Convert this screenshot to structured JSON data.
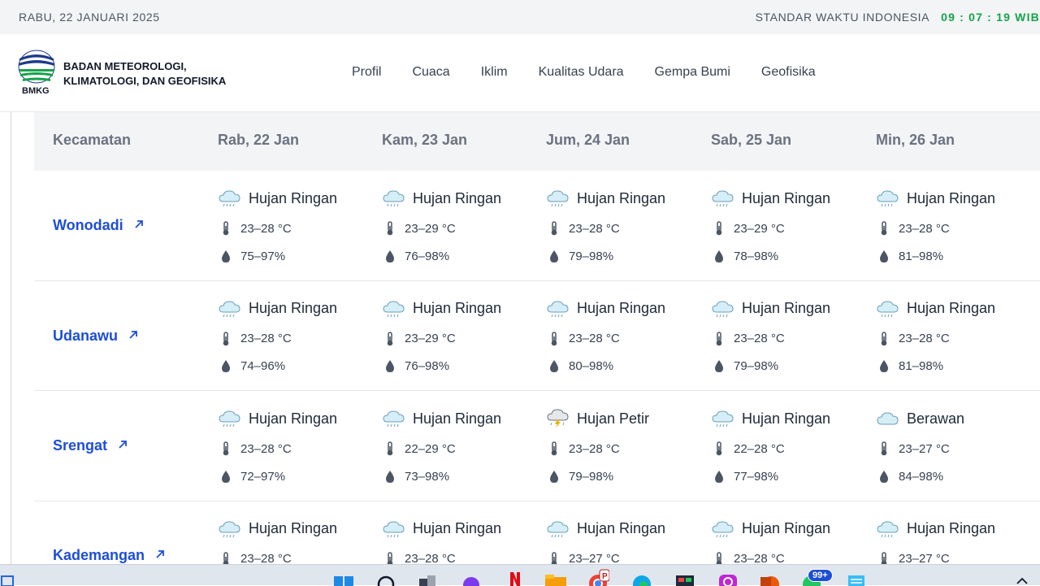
{
  "topbar": {
    "date": "RABU, 22 JANUARI 2025",
    "tz_label": "STANDAR WAKTU INDONESIA",
    "clock": "09 : 07 : 19 WIB"
  },
  "brand": {
    "line1": "BADAN METEOROLOGI,",
    "line2": "KLIMATOLOGI, DAN GEOFISIKA",
    "logo_text": "BMKG"
  },
  "nav": [
    "Profil",
    "Cuaca",
    "Iklim",
    "Kualitas Udara",
    "Gempa Bumi",
    "Geofisika"
  ],
  "table": {
    "col_header": "Kecamatan",
    "days": [
      "Rab, 22 Jan",
      "Kam, 23 Jan",
      "Jum, 24 Jan",
      "Sab, 25 Jan",
      "Min, 26 Jan"
    ],
    "rows": [
      {
        "name": "Wonodadi",
        "cells": [
          {
            "wx": "Hujan Ringan",
            "icon": "cloud-rain-icon",
            "temp": "23–28 °C",
            "rh": "75–97%"
          },
          {
            "wx": "Hujan Ringan",
            "icon": "cloud-rain-icon",
            "temp": "23–29 °C",
            "rh": "76–98%"
          },
          {
            "wx": "Hujan Ringan",
            "icon": "cloud-rain-icon",
            "temp": "23–28 °C",
            "rh": "79–98%"
          },
          {
            "wx": "Hujan Ringan",
            "icon": "cloud-rain-icon",
            "temp": "23–29 °C",
            "rh": "78–98%"
          },
          {
            "wx": "Hujan Ringan",
            "icon": "cloud-rain-icon",
            "temp": "23–28 °C",
            "rh": "81–98%"
          }
        ]
      },
      {
        "name": "Udanawu",
        "cells": [
          {
            "wx": "Hujan Ringan",
            "icon": "cloud-rain-icon",
            "temp": "23–28 °C",
            "rh": "74–96%"
          },
          {
            "wx": "Hujan Ringan",
            "icon": "cloud-rain-icon",
            "temp": "23–29 °C",
            "rh": "76–98%"
          },
          {
            "wx": "Hujan Ringan",
            "icon": "cloud-rain-icon",
            "temp": "23–28 °C",
            "rh": "80–98%"
          },
          {
            "wx": "Hujan Ringan",
            "icon": "cloud-rain-icon",
            "temp": "23–28 °C",
            "rh": "79–98%"
          },
          {
            "wx": "Hujan Ringan",
            "icon": "cloud-rain-icon",
            "temp": "23–28 °C",
            "rh": "81–98%"
          }
        ]
      },
      {
        "name": "Srengat",
        "cells": [
          {
            "wx": "Hujan Ringan",
            "icon": "cloud-rain-icon",
            "temp": "23–28 °C",
            "rh": "72–97%"
          },
          {
            "wx": "Hujan Ringan",
            "icon": "cloud-rain-icon",
            "temp": "22–29 °C",
            "rh": "73–98%"
          },
          {
            "wx": "Hujan Petir",
            "icon": "thunderstorm-icon",
            "temp": "23–28 °C",
            "rh": "79–98%"
          },
          {
            "wx": "Hujan Ringan",
            "icon": "cloud-rain-icon",
            "temp": "22–28 °C",
            "rh": "77–98%"
          },
          {
            "wx": "Berawan",
            "icon": "cloud-icon",
            "temp": "23–27 °C",
            "rh": "84–98%"
          }
        ]
      },
      {
        "name": "Kademangan",
        "cells": [
          {
            "wx": "Hujan Ringan",
            "icon": "cloud-rain-icon",
            "temp": "23–28 °C",
            "rh": ""
          },
          {
            "wx": "Hujan Ringan",
            "icon": "cloud-rain-icon",
            "temp": "23–28 °C",
            "rh": ""
          },
          {
            "wx": "Hujan Ringan",
            "icon": "cloud-rain-icon",
            "temp": "23–27 °C",
            "rh": ""
          },
          {
            "wx": "Hujan Ringan",
            "icon": "cloud-rain-icon",
            "temp": "23–28 °C",
            "rh": ""
          },
          {
            "wx": "Hujan Ringan",
            "icon": "cloud-rain-icon",
            "temp": "23–27 °C",
            "rh": ""
          }
        ]
      }
    ]
  },
  "taskbar": {
    "badge": "99+",
    "icons": [
      "widgets-icon",
      "windows-start-icon",
      "search-icon",
      "task-view-icon",
      "chat-icon",
      "netflix-icon",
      "file-explorer-icon",
      "chrome-icon",
      "edge-icon",
      "store-icon",
      "instagram-icon",
      "powerpoint-icon",
      "whatsapp-icon",
      "notepad-icon",
      "chevron-up-icon"
    ]
  },
  "colors": {
    "link": "#1d4ed8",
    "clock": "#16a34a",
    "header_bg": "#f3f4f6"
  }
}
